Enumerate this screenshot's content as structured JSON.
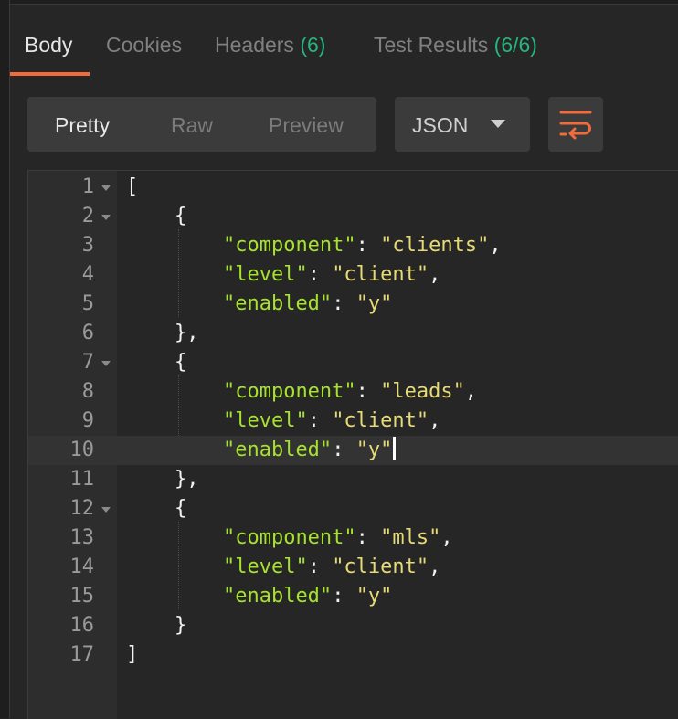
{
  "tabs": [
    {
      "label": "Body",
      "count": ""
    },
    {
      "label": "Cookies",
      "count": ""
    },
    {
      "label": "Headers",
      "count": "(6)"
    },
    {
      "label": "Test Results",
      "count": "(6/6)"
    }
  ],
  "view_modes": [
    "Pretty",
    "Raw",
    "Preview"
  ],
  "format_select": {
    "value": "JSON"
  },
  "icons": {
    "wrap": "wrap-lines-icon",
    "fold": "fold-arrow-icon"
  },
  "colors": {
    "accent": "#f26b3a",
    "count": "#26b47f",
    "key": "#a6e22e",
    "string": "#e6db74"
  },
  "editor": {
    "active_line": 10,
    "lines": [
      {
        "n": "1",
        "indent": "",
        "pre": "[",
        "key": "",
        "sep": "",
        "val": "",
        "post": ""
      },
      {
        "n": "2",
        "indent": "    ",
        "pre": "{",
        "key": "",
        "sep": "",
        "val": "",
        "post": ""
      },
      {
        "n": "3",
        "indent": "        ",
        "pre": "",
        "key": "\"component\"",
        "sep": ": ",
        "val": "\"clients\"",
        "post": ","
      },
      {
        "n": "4",
        "indent": "        ",
        "pre": "",
        "key": "\"level\"",
        "sep": ": ",
        "val": "\"client\"",
        "post": ","
      },
      {
        "n": "5",
        "indent": "        ",
        "pre": "",
        "key": "\"enabled\"",
        "sep": ": ",
        "val": "\"y\"",
        "post": ""
      },
      {
        "n": "6",
        "indent": "    ",
        "pre": "},",
        "key": "",
        "sep": "",
        "val": "",
        "post": ""
      },
      {
        "n": "7",
        "indent": "    ",
        "pre": "{",
        "key": "",
        "sep": "",
        "val": "",
        "post": ""
      },
      {
        "n": "8",
        "indent": "        ",
        "pre": "",
        "key": "\"component\"",
        "sep": ": ",
        "val": "\"leads\"",
        "post": ","
      },
      {
        "n": "9",
        "indent": "        ",
        "pre": "",
        "key": "\"level\"",
        "sep": ": ",
        "val": "\"client\"",
        "post": ","
      },
      {
        "n": "10",
        "indent": "        ",
        "pre": "",
        "key": "\"enabled\"",
        "sep": ": ",
        "val": "\"y\"",
        "post": ""
      },
      {
        "n": "11",
        "indent": "    ",
        "pre": "},",
        "key": "",
        "sep": "",
        "val": "",
        "post": ""
      },
      {
        "n": "12",
        "indent": "    ",
        "pre": "{",
        "key": "",
        "sep": "",
        "val": "",
        "post": ""
      },
      {
        "n": "13",
        "indent": "        ",
        "pre": "",
        "key": "\"component\"",
        "sep": ": ",
        "val": "\"mls\"",
        "post": ","
      },
      {
        "n": "14",
        "indent": "        ",
        "pre": "",
        "key": "\"level\"",
        "sep": ": ",
        "val": "\"client\"",
        "post": ","
      },
      {
        "n": "15",
        "indent": "        ",
        "pre": "",
        "key": "\"enabled\"",
        "sep": ": ",
        "val": "\"y\"",
        "post": ""
      },
      {
        "n": "16",
        "indent": "    ",
        "pre": "}",
        "key": "",
        "sep": "",
        "val": "",
        "post": ""
      },
      {
        "n": "17",
        "indent": "",
        "pre": "]",
        "key": "",
        "sep": "",
        "val": "",
        "post": ""
      }
    ]
  }
}
